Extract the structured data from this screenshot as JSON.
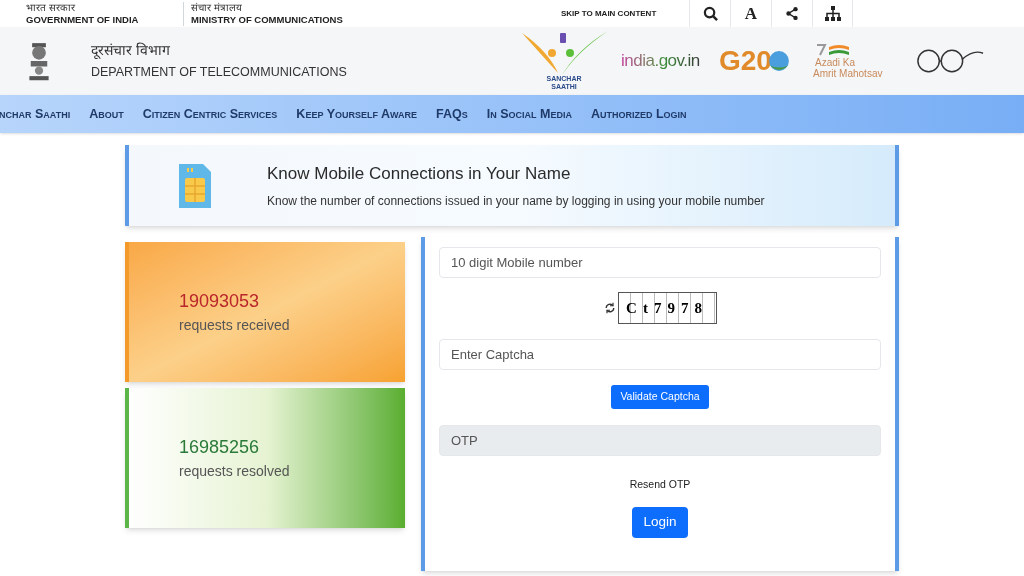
{
  "top_bar": {
    "government": {
      "hindi": "भारत सरकार",
      "english": "GOVERNMENT OF INDIA"
    },
    "ministry": {
      "hindi": "संचार मंत्रालय",
      "english": "MINISTRY OF COMMUNICATIONS"
    },
    "skip_link": "SKIP TO MAIN CONTENT",
    "tools": [
      {
        "kind": "search"
      },
      {
        "kind": "text",
        "label": "A"
      },
      {
        "kind": "share"
      },
      {
        "kind": "sitemap"
      }
    ]
  },
  "header": {
    "hindi": "दूरसंचार विभाग",
    "english": "DEPARTMENT OF TELECOMMUNICATIONS",
    "logos": [
      {
        "kind": "sanchar",
        "lines": [
          "SANCHAR",
          "SAATHI"
        ]
      },
      {
        "kind": "india",
        "lines": [
          "india.gov.in"
        ]
      },
      {
        "kind": "g20",
        "lines": [
          "G20"
        ]
      },
      {
        "kind": "azadi",
        "lines": [
          "Azadi Ka",
          "Amrit Mahotsav"
        ]
      },
      {
        "kind": "swachh"
      }
    ]
  },
  "nav": {
    "items": [
      "nchar Saathi",
      "About",
      "Citizen Centric Services",
      "Keep Yourself Aware",
      "FAQs",
      "In Social Media",
      "Authorized Login"
    ]
  },
  "banner": {
    "title": "Know Mobile Connections in Your Name",
    "subtitle": "Know the number of connections issued in your name by logging in using your mobile number"
  },
  "stats": [
    {
      "kind": "received",
      "count": "19093053",
      "label": "requests received"
    },
    {
      "kind": "resolved",
      "count": "16985256",
      "label": "requests resolved"
    }
  ],
  "form": {
    "mobile_placeholder": "10 digit Mobile number",
    "captcha": "Ct7978",
    "captcha_placeholder": "Enter Captcha",
    "validate_button": "Validate Captcha",
    "otp": {
      "placeholder": "OTP",
      "disabled": true
    },
    "resend": "Resend OTP",
    "login_button": "Login"
  }
}
